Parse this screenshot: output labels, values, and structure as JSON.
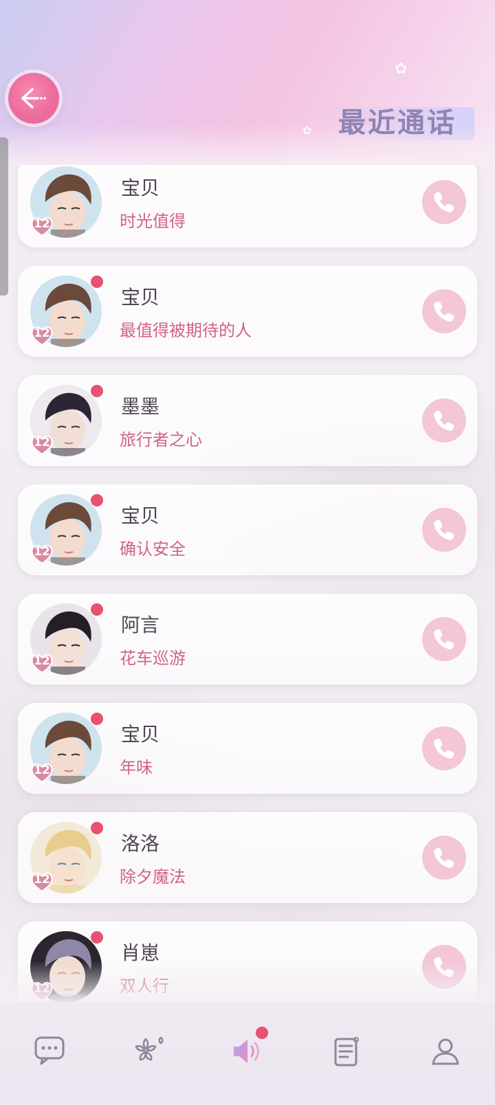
{
  "header": {
    "title": "最近通话",
    "back_icon": "back-arrow-icon"
  },
  "colors": {
    "accent_pink": "#e86a98",
    "name_text": "#4f4453",
    "subtitle_text": "#d16386",
    "call_button_bg": "#f3c6d8",
    "unread_dot": "#e8516f",
    "title_color": "#8f84b4"
  },
  "calls": [
    {
      "name": "宝贝",
      "title": "时光值得",
      "level": "12",
      "unread": false,
      "avatar": "avatar-brown-hair-headset"
    },
    {
      "name": "宝贝",
      "title": "最值得被期待的人",
      "level": "12",
      "unread": true,
      "avatar": "avatar-brown-hair-headset"
    },
    {
      "name": "墨墨",
      "title": "旅行者之心",
      "level": "12",
      "unread": true,
      "avatar": "avatar-black-hair"
    },
    {
      "name": "宝贝",
      "title": "确认安全",
      "level": "12",
      "unread": true,
      "avatar": "avatar-brown-hair-headset"
    },
    {
      "name": "阿言",
      "title": "花车巡游",
      "level": "12",
      "unread": true,
      "avatar": "avatar-black-hair-suit"
    },
    {
      "name": "宝贝",
      "title": "年味",
      "level": "12",
      "unread": true,
      "avatar": "avatar-brown-hair-headset"
    },
    {
      "name": "洛洛",
      "title": "除夕魔法",
      "level": "12",
      "unread": true,
      "avatar": "avatar-blonde-hair"
    },
    {
      "name": "肖崽",
      "title": "双人行",
      "level": "12",
      "unread": true,
      "avatar": "avatar-silver-hair"
    }
  ],
  "nav": [
    {
      "name": "messages",
      "icon": "chat-bubble-icon",
      "active": false,
      "badge": false
    },
    {
      "name": "moments",
      "icon": "sakura-flower-icon",
      "active": false,
      "badge": false
    },
    {
      "name": "calls",
      "icon": "speaker-icon",
      "active": true,
      "badge": true
    },
    {
      "name": "news",
      "icon": "document-icon",
      "active": false,
      "badge": false
    },
    {
      "name": "profile",
      "icon": "person-icon",
      "active": false,
      "badge": false
    }
  ]
}
